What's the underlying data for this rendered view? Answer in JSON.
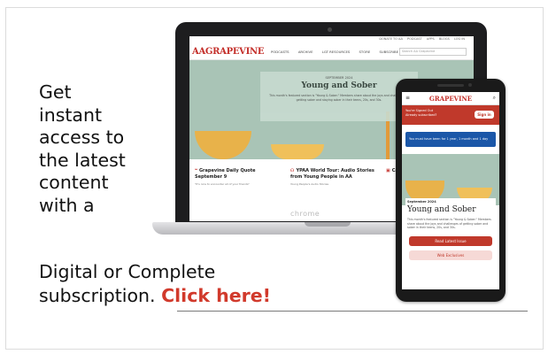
{
  "promo": {
    "lines": [
      "Get",
      "instant",
      "access to",
      "the latest",
      "content",
      "with a"
    ],
    "wide_line": "Digital or Complete",
    "final_prefix": "subscription.",
    "cta_label": "Click here!",
    "accent_color": "#d13a2c"
  },
  "laptop": {
    "logo": "AAGRAPEVINE",
    "top_links": [
      "DONATE TO AA",
      "PODCAST",
      "APPS",
      "BLOGS",
      "LOG IN"
    ],
    "nav_items": [
      "PODCASTS",
      "ARCHIVE",
      "LGT RESOURCES",
      "STORE",
      "SUBSCRIBE"
    ],
    "search_placeholder": "Search AA Grapevine",
    "hero_kicker": "SEPTEMBER 2024",
    "hero_title": "Young and Sober",
    "hero_desc": "This month's featured section is \"Young & Sober.\" Members share about the joys and challenges of getting sober and staying sober in their teens, 20s, and 30s.",
    "cards": [
      {
        "title": "Grapevine Daily Quote September 9",
        "sub": "\"It's nice to encounter all of your friends\""
      },
      {
        "title": "YPAA World Tour: Audio Stories from Young People in AA",
        "sub": "Young People's Audio Stories"
      },
      {
        "title": "Cal...",
        "sub": ""
      }
    ],
    "browser_label": "chrome"
  },
  "phone": {
    "logo": "GRAPEVINE",
    "signin_msg": "You're Signed Out",
    "signin_sub": "Already subscribed?",
    "signin_button": "Sign in",
    "notice": "You must have been for 1 year, 1 month and 1 day",
    "kicker": "September 2024",
    "title": "Young and Sober",
    "desc": "This month's featured section is \"Young & Sober.\" Members share about the joys and challenges of getting sober and sober in their teens, 20s, and 30s.",
    "btn_primary": "Read Latest Issue",
    "btn_secondary": "Web Exclusives"
  }
}
